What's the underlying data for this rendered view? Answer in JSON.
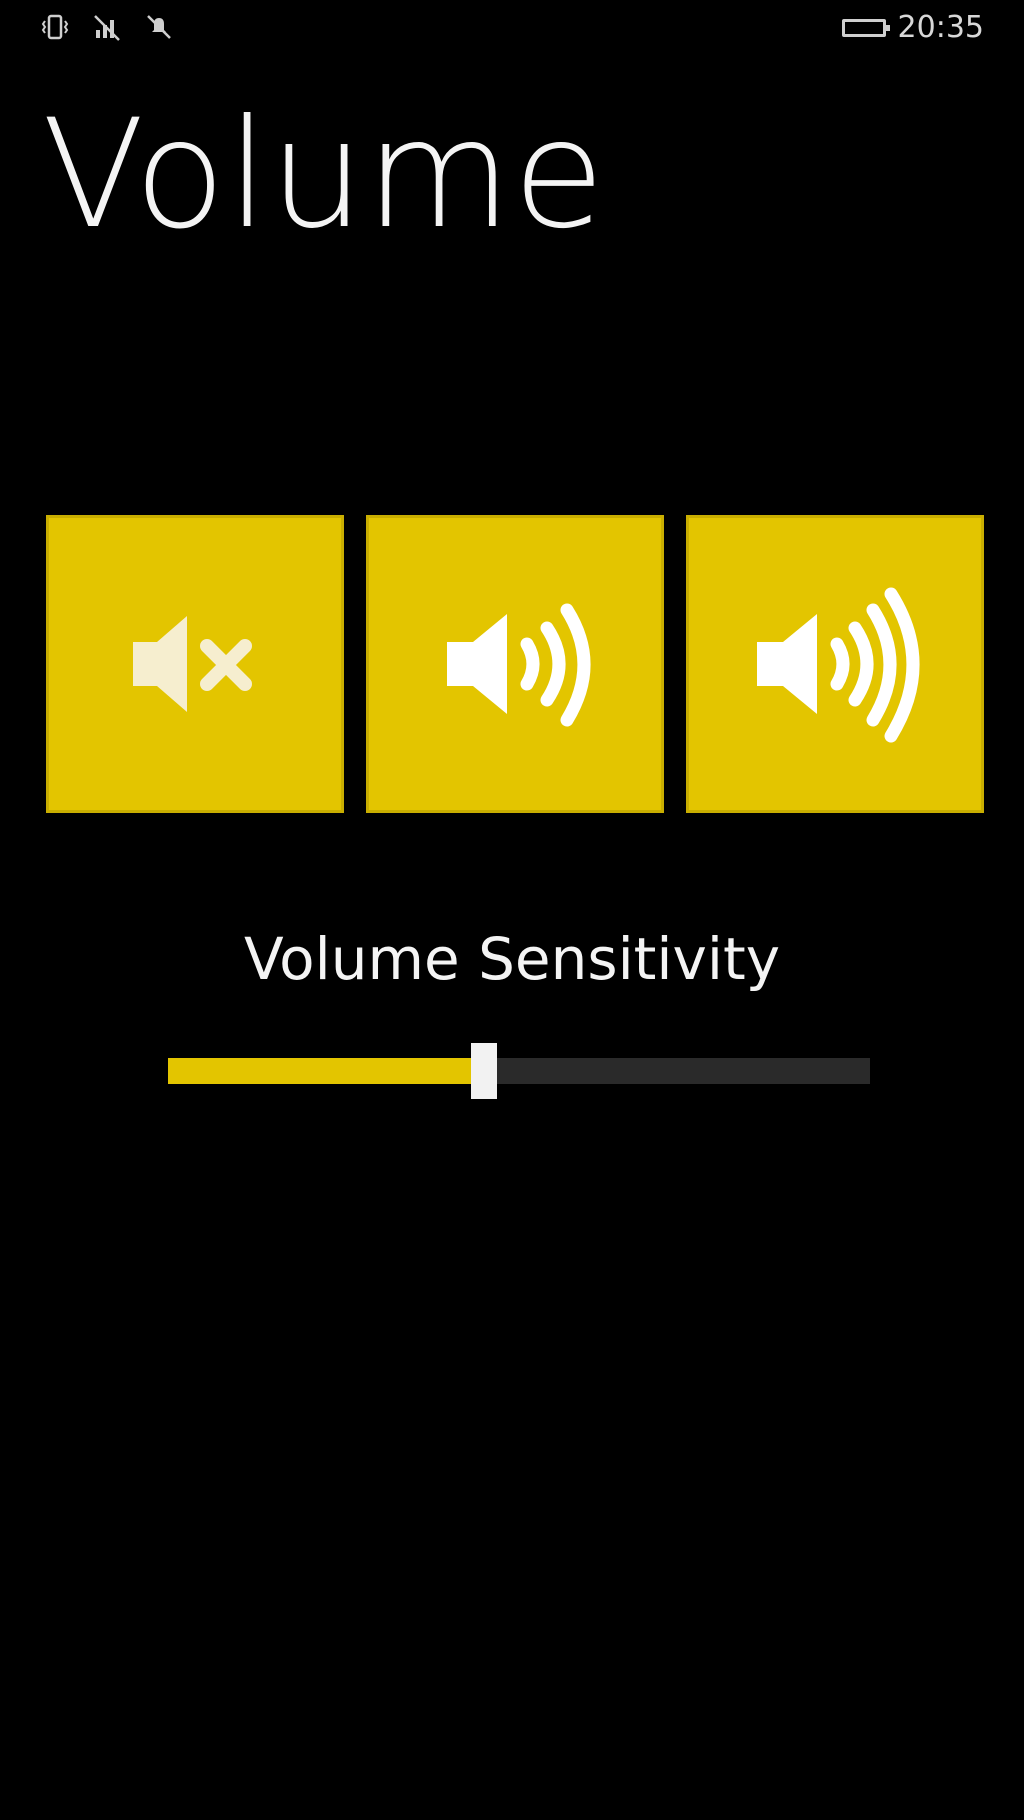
{
  "status_bar": {
    "time": "20:35",
    "icons": [
      "vibrate-icon",
      "no-signal-icon",
      "quiet-hours-icon",
      "battery-icon"
    ]
  },
  "page": {
    "title": "Volume"
  },
  "tiles": [
    {
      "name": "mute",
      "icon": "speaker-mute-icon"
    },
    {
      "name": "medium",
      "icon": "speaker-medium-icon"
    },
    {
      "name": "loud",
      "icon": "speaker-loud-icon"
    }
  ],
  "sensitivity": {
    "label": "Volume Sensitivity",
    "value_percent": 45
  },
  "colors": {
    "accent": "#e3c500",
    "background": "#000000",
    "track": "#2a2a2a",
    "text": "#f4f4f4"
  }
}
